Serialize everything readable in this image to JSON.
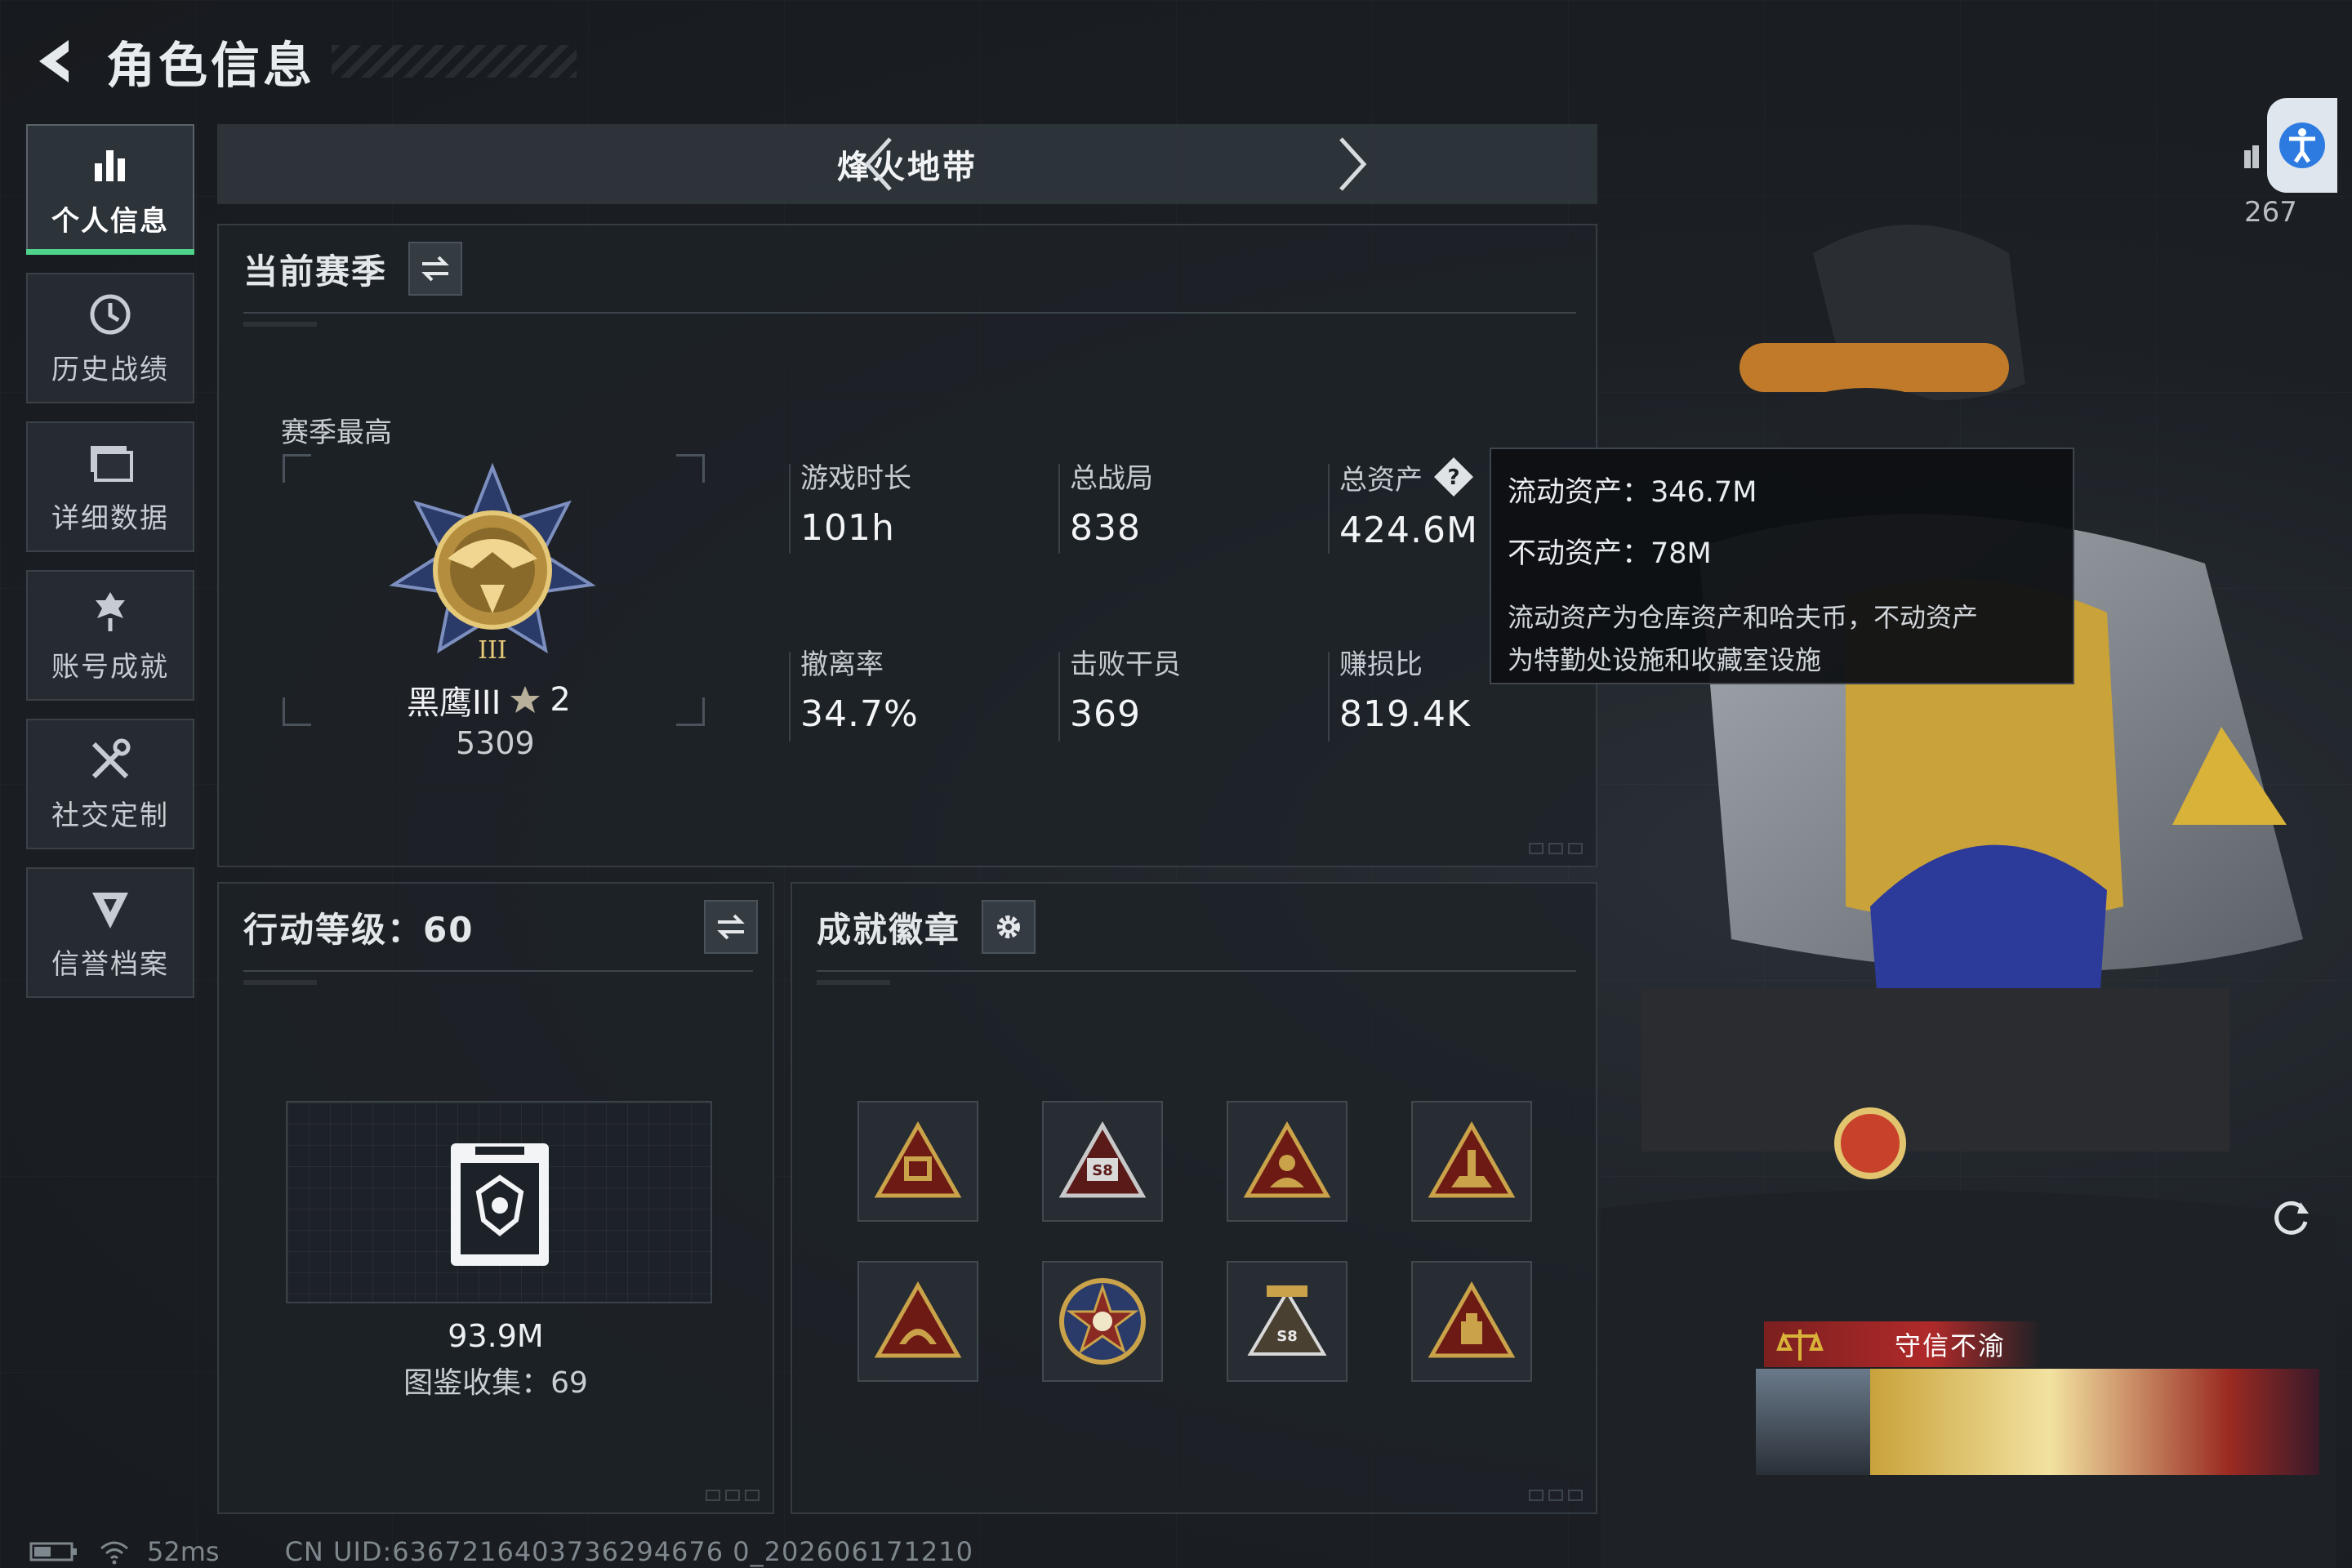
{
  "header": {
    "title": "角色信息"
  },
  "nav": {
    "items": [
      {
        "label": "个人信息",
        "icon": "bar-chart-icon",
        "active": true
      },
      {
        "label": "历史战绩",
        "icon": "history-clock-icon"
      },
      {
        "label": "详细数据",
        "icon": "data-folder-icon"
      },
      {
        "label": "账号成就",
        "icon": "achievement-icon"
      },
      {
        "label": "社交定制",
        "icon": "tools-icon"
      },
      {
        "label": "信誉档案",
        "icon": "credit-shield-icon"
      }
    ]
  },
  "mode": {
    "title": "烽火地带"
  },
  "season": {
    "title": "当前赛季",
    "best_label": "赛季最高",
    "rank_name": "黑鹰III",
    "rank_stars": "2",
    "rank_score": "5309",
    "stats": [
      {
        "label": "游戏时长",
        "value": "101h"
      },
      {
        "label": "总战局",
        "value": "838"
      },
      {
        "label": "总资产",
        "value": "424.6M"
      },
      {
        "label": "撤离率",
        "value": "34.7%"
      },
      {
        "label": "击败干员",
        "value": "369"
      },
      {
        "label": "赚损比",
        "value": "819.4K"
      }
    ]
  },
  "tooltip": {
    "liquid": "流动资产：346.7M",
    "fixed": "不动资产：78M",
    "desc_line1": "流动资产为仓库资产和哈夫币，不动资产",
    "desc_line2": "为特勤处设施和收藏室设施"
  },
  "action_level": {
    "title": "行动等级：60",
    "showcase_value": "93.9M",
    "collection": "图鉴收集：69"
  },
  "achievements": {
    "title": "成就徽章",
    "badges": [
      "badge-1-icon",
      "badge-2-icon",
      "badge-3-icon",
      "badge-4-icon",
      "badge-5-icon",
      "badge-6-icon",
      "badge-7-icon",
      "badge-8-icon"
    ]
  },
  "right": {
    "count": "267",
    "credit_badge": "守信不渝"
  },
  "footer": {
    "ping": "52ms",
    "uid": "CN UID:6367216403736294676 0_202606171210"
  },
  "colors": {
    "accent_green": "#4fd28a",
    "gold": "#c9a24a",
    "credit_red": "#b12a2a"
  }
}
